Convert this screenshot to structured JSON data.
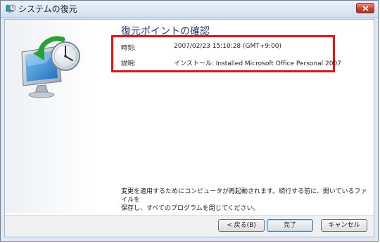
{
  "window": {
    "title": "システムの復元"
  },
  "main": {
    "heading": "復元ポイントの確認",
    "rows": [
      {
        "label": "時刻:",
        "value": "2007/02/23 15:10:28 (GMT+9:00)"
      },
      {
        "label": "説明:",
        "value": "インストール: Installed Microsoft Office Personal 2007"
      }
    ],
    "footer_line1": "変更を適用するためにコンピュータが再起動されます。続行する前に、開いているファイルを",
    "footer_line2": "保存し、すべてのプログラムを閉じてください。"
  },
  "buttons": {
    "back": "< 戻る(B)",
    "finish": "完了",
    "cancel": "キャンセル"
  },
  "colors": {
    "highlight_border": "#ef1010",
    "heading": "#1f3a8c"
  },
  "icons": {
    "app": "system-restore-icon",
    "graphic": "restore-clock-monitor-icon",
    "close": "close-icon"
  }
}
